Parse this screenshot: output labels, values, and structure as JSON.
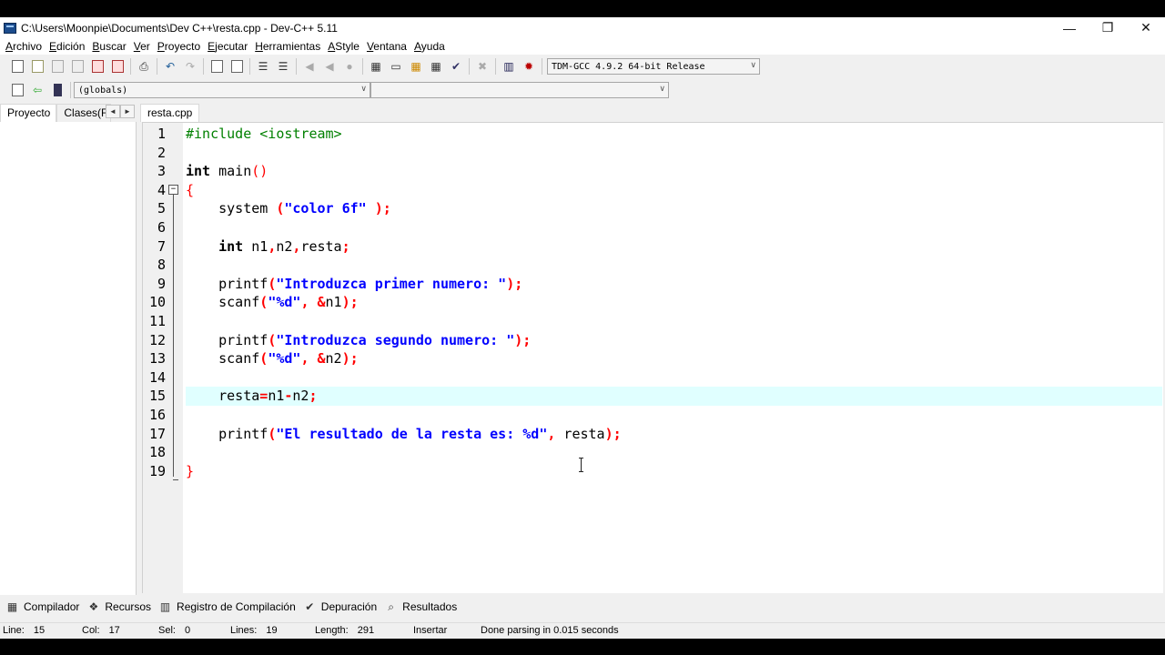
{
  "window": {
    "title": "C:\\Users\\Moonpie\\Documents\\Dev C++\\resta.cpp - Dev-C++ 5.11",
    "minimize": "—",
    "restore": "❐",
    "close": "✕"
  },
  "menu": [
    {
      "first": "A",
      "rest": "rchivo"
    },
    {
      "first": "E",
      "rest": "dición"
    },
    {
      "first": "B",
      "rest": "uscar"
    },
    {
      "first": "V",
      "rest": "er"
    },
    {
      "first": "P",
      "rest": "royecto"
    },
    {
      "first": "E",
      "rest": "jecutar"
    },
    {
      "first": "H",
      "rest": "erramientas"
    },
    {
      "first": "A",
      "rest": "Style"
    },
    {
      "first": "V",
      "rest": "entana"
    },
    {
      "first": "A",
      "rest": "yuda"
    }
  ],
  "toolbar": {
    "compiler": "TDM-GCC 4.9.2 64-bit Release",
    "scope": "(globals)",
    "members": ""
  },
  "left_panel": {
    "tabs": [
      "Proyecto",
      "Clases(Funciones)"
    ],
    "arrow_left": "◄",
    "arrow_right": "►"
  },
  "editor": {
    "file_tab": "resta.cpp",
    "highlighted_line": 15,
    "line_numbers": [
      "1",
      "2",
      "3",
      "4",
      "5",
      "6",
      "7",
      "8",
      "9",
      "10",
      "11",
      "12",
      "13",
      "14",
      "15",
      "16",
      "17",
      "18",
      "19"
    ],
    "code": {
      "l1_pp": "#include <iostream>",
      "l3_kw": "int",
      "l3_rest": " main",
      "l3_paren": "()",
      "l4_brace": "{",
      "l5_fn": "    system ",
      "l5_open": "(",
      "l5_str": "\"color 6f\"",
      "l5_close": " );",
      "l7_kw": "    int",
      "l7_a": " n1",
      "l7_c1": ",",
      "l7_b": "n2",
      "l7_c2": ",",
      "l7_c": "resta",
      "l7_semi": ";",
      "l9_fn": "    printf",
      "l9_open": "(",
      "l9_str": "\"Introduzca primer numero: \"",
      "l9_close": ");",
      "l10_fn": "    scanf",
      "l10_open": "(",
      "l10_str": "\"%d\"",
      "l10_comma": ", &",
      "l10_var": "n1",
      "l10_close": ");",
      "l12_fn": "    printf",
      "l12_open": "(",
      "l12_str": "\"Introduzca segundo numero: \"",
      "l12_close": ");",
      "l13_fn": "    scanf",
      "l13_open": "(",
      "l13_str": "\"%d\"",
      "l13_comma": ", &",
      "l13_var": "n2",
      "l13_close": ");",
      "l15_a": "    resta",
      "l15_eq": "=",
      "l15_b": "n1",
      "l15_minus": "-",
      "l15_c": "n2",
      "l15_semi": ";",
      "l17_fn": "    printf",
      "l17_open": "(",
      "l17_str": "\"El resultado de la resta es: %d\"",
      "l17_comma": ",",
      "l17_var": " resta",
      "l17_close": ");",
      "l19_brace": "}"
    }
  },
  "bottom_tabs": [
    "Compilador",
    "Recursos",
    "Registro de Compilación",
    "Depuración",
    "Resultados"
  ],
  "status": {
    "line_label": "Line:",
    "line": "15",
    "col_label": "Col:",
    "col": "17",
    "sel_label": "Sel:",
    "sel": "0",
    "lines_label": "Lines:",
    "lines": "19",
    "length_label": "Length:",
    "length": "291",
    "mode": "Insertar",
    "message": "Done parsing in 0.015 seconds"
  }
}
